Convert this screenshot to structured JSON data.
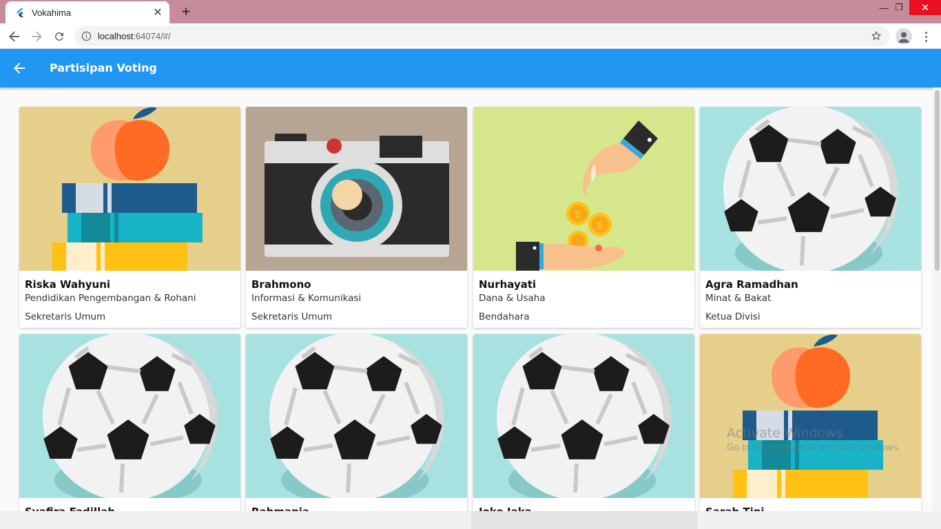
{
  "browser": {
    "tab_title": "Vokahima",
    "url_host": "localhost",
    "url_rest": ":64074/#/",
    "icons": [
      "flutter-icon",
      "close-icon",
      "plus-icon",
      "back-icon",
      "forward-icon",
      "reload-icon",
      "info-icon",
      "star-icon",
      "profile-icon",
      "menu-icon"
    ]
  },
  "appbar": {
    "title": "Partisipan Voting",
    "color": "#2196f3"
  },
  "cards": [
    {
      "name": "Riska Wahyuni",
      "division": "Pendidikan Pengembangan & Rohani",
      "role": "Sekretaris Umum",
      "image": "books-apple",
      "bg": "#e6cf8a"
    },
    {
      "name": "Brahmono",
      "division": "Informasi & Komunikasi",
      "role": "Sekretaris Umum",
      "image": "camera",
      "bg": "#b5a592"
    },
    {
      "name": "Nurhayati",
      "division": "Dana & Usaha",
      "role": "Bendahara",
      "image": "hands-coins",
      "bg": "#d5e68c"
    },
    {
      "name": "Agra Ramadhan",
      "division": "Minat & Bakat",
      "role": "Ketua Divisi",
      "image": "soccer-ball",
      "bg": "#a7e1e0"
    },
    {
      "name": "Syafira Fadillah",
      "division": "",
      "role": "",
      "image": "soccer-ball",
      "bg": "#a7e1e0"
    },
    {
      "name": "Rahmania",
      "division": "",
      "role": "",
      "image": "soccer-ball",
      "bg": "#a7e1e0"
    },
    {
      "name": "Joko Jaka",
      "division": "",
      "role": "",
      "image": "soccer-ball",
      "bg": "#a7e1e0"
    },
    {
      "name": "Sarah Tini",
      "division": "",
      "role": "",
      "image": "books-apple",
      "bg": "#e6cf8a"
    }
  ],
  "watermark": {
    "title": "Activate Windows",
    "subtitle": "Go to PC settings to activate Windows."
  }
}
